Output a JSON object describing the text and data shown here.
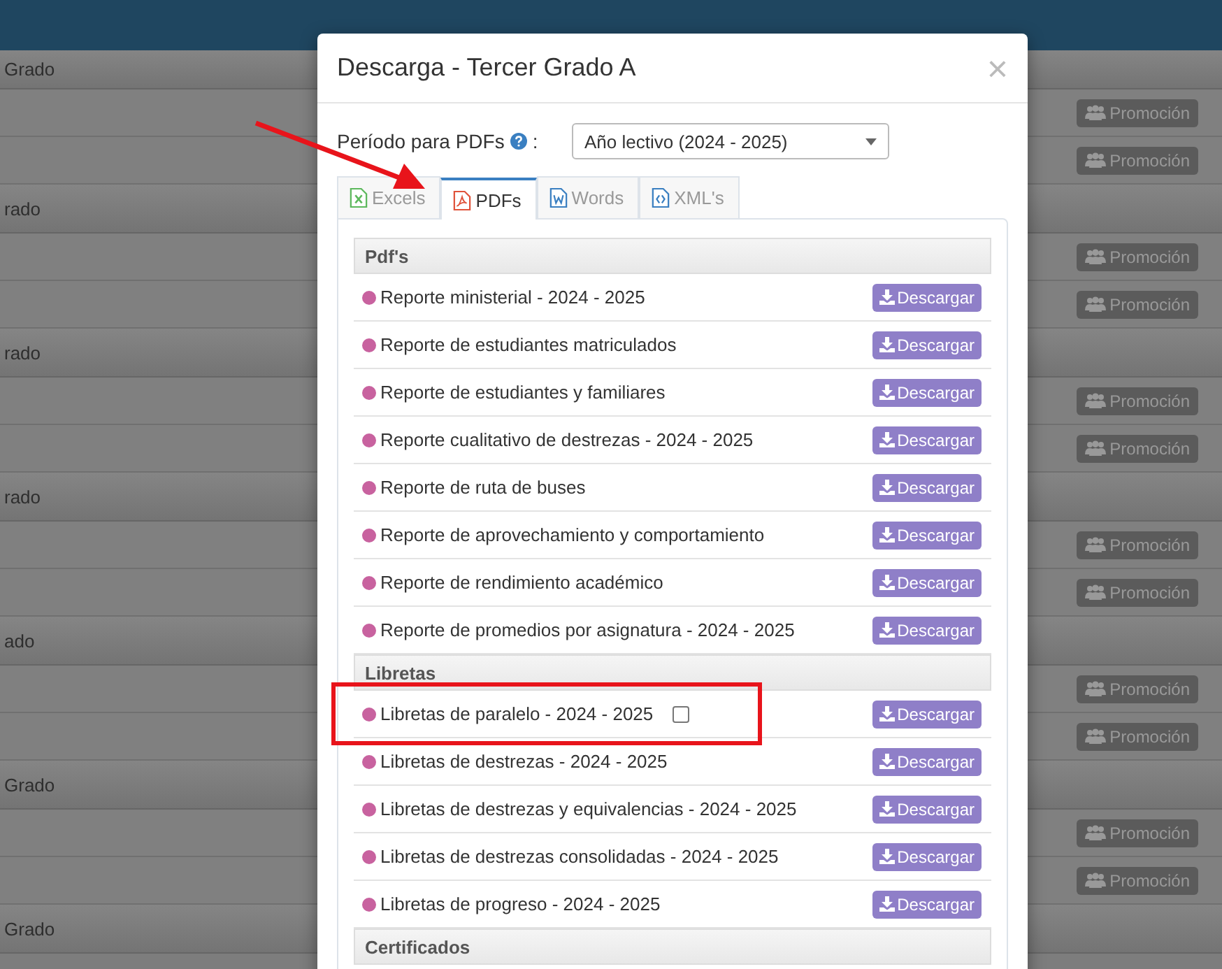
{
  "background": {
    "groups": [
      {
        "title": "Grado",
        "rows": [
          {
            "button": "Promoción"
          },
          {
            "button": "Promoción"
          }
        ]
      },
      {
        "title": "rado",
        "rows": [
          {
            "button": "Promoción"
          },
          {
            "button": "Promoción"
          }
        ]
      },
      {
        "title": "rado",
        "rows": [
          {
            "button": "Promoción"
          },
          {
            "button": "Promoción"
          }
        ]
      },
      {
        "title": "rado",
        "rows": [
          {
            "button": "Promoción"
          },
          {
            "button": "Promoción"
          }
        ]
      },
      {
        "title": "ado",
        "rows": [
          {
            "button": "Promoción"
          },
          {
            "button": "Promoción"
          }
        ]
      },
      {
        "title": "Grado",
        "rows": [
          {
            "button": "Promoción"
          },
          {
            "button": "Promoción"
          }
        ]
      },
      {
        "title": "Grado"
      }
    ]
  },
  "modal": {
    "title": "Descarga - Tercer Grado A",
    "close": "×",
    "period": {
      "label": "Período para PDFs",
      "separator": ":",
      "value": "Año lectivo (2024 - 2025)"
    },
    "tabs": [
      {
        "label": "Excels",
        "kind": "excel",
        "selected": false
      },
      {
        "label": "PDFs",
        "kind": "pdf",
        "selected": true
      },
      {
        "label": "Words",
        "kind": "word",
        "selected": false
      },
      {
        "label": "XML's",
        "kind": "xml",
        "selected": false
      }
    ],
    "sections": [
      {
        "title": "Pdf's",
        "items": [
          {
            "label": "Reporte ministerial - 2024 - 2025",
            "button": "Descargar"
          },
          {
            "label": "Reporte de estudiantes matriculados",
            "button": "Descargar"
          },
          {
            "label": "Reporte de estudiantes y familiares",
            "button": "Descargar"
          },
          {
            "label": "Reporte cualitativo de destrezas - 2024 - 2025",
            "button": "Descargar"
          },
          {
            "label": "Reporte de ruta de buses",
            "button": "Descargar"
          },
          {
            "label": "Reporte de aprovechamiento y comportamiento",
            "button": "Descargar"
          },
          {
            "label": "Reporte de rendimiento académico",
            "button": "Descargar"
          },
          {
            "label": "Reporte de promedios por asignatura - 2024 - 2025",
            "button": "Descargar"
          }
        ]
      },
      {
        "title": "Libretas",
        "items": [
          {
            "label": "Libretas de paralelo - 2024 - 2025",
            "checked": false,
            "button": "Descargar"
          },
          {
            "label": "Libretas de destrezas - 2024 - 2025",
            "button": "Descargar"
          },
          {
            "label": "Libretas de destrezas y equivalencias - 2024 - 2025",
            "button": "Descargar"
          },
          {
            "label": "Libretas de destrezas consolidadas - 2024 - 2025",
            "button": "Descargar"
          },
          {
            "label": "Libretas de progreso - 2024 - 2025",
            "button": "Descargar"
          }
        ]
      },
      {
        "title": "Certificados"
      }
    ]
  }
}
